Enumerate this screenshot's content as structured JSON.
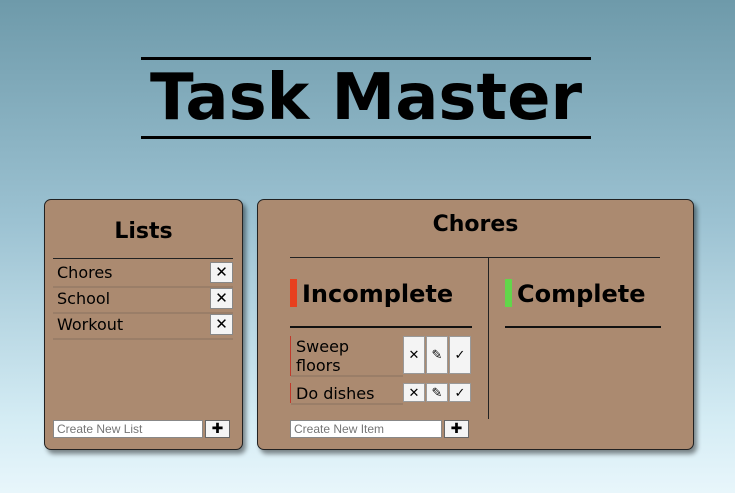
{
  "app": {
    "title": "Task Master"
  },
  "lists": {
    "heading": "Lists",
    "items": [
      {
        "label": "Chores",
        "delete": "✕"
      },
      {
        "label": "School",
        "delete": "✕"
      },
      {
        "label": "Workout",
        "delete": "✕"
      }
    ],
    "new_placeholder": "Create New List",
    "add_label": "✚"
  },
  "chores": {
    "heading": "Chores",
    "incomplete_title": "Incomplete",
    "complete_title": "Complete",
    "incomplete_color": "#e8401e",
    "complete_color": "#62d64a",
    "tasks": [
      {
        "label_line1": "Sweep",
        "label_line2": "floors",
        "delete": "✕",
        "edit": "✎",
        "done": "✓"
      },
      {
        "label": "Do dishes",
        "delete": "✕",
        "edit": "✎",
        "done": "✓"
      }
    ],
    "new_placeholder": "Create New Item",
    "add_label": "✚"
  }
}
